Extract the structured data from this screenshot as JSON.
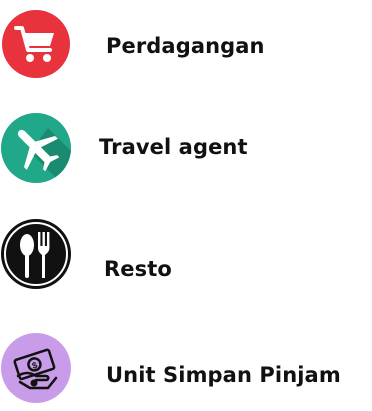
{
  "categories": [
    {
      "label": "Perdagangan",
      "icon": "shopping-cart-icon",
      "color": "#e8323c"
    },
    {
      "label": "Travel agent",
      "icon": "airplane-icon",
      "color": "#20a889"
    },
    {
      "label": "Resto",
      "icon": "fork-spoon-icon",
      "color": "#111111"
    },
    {
      "label": "Unit Simpan Pinjam",
      "icon": "money-icon",
      "color": "#c99ce9"
    }
  ]
}
